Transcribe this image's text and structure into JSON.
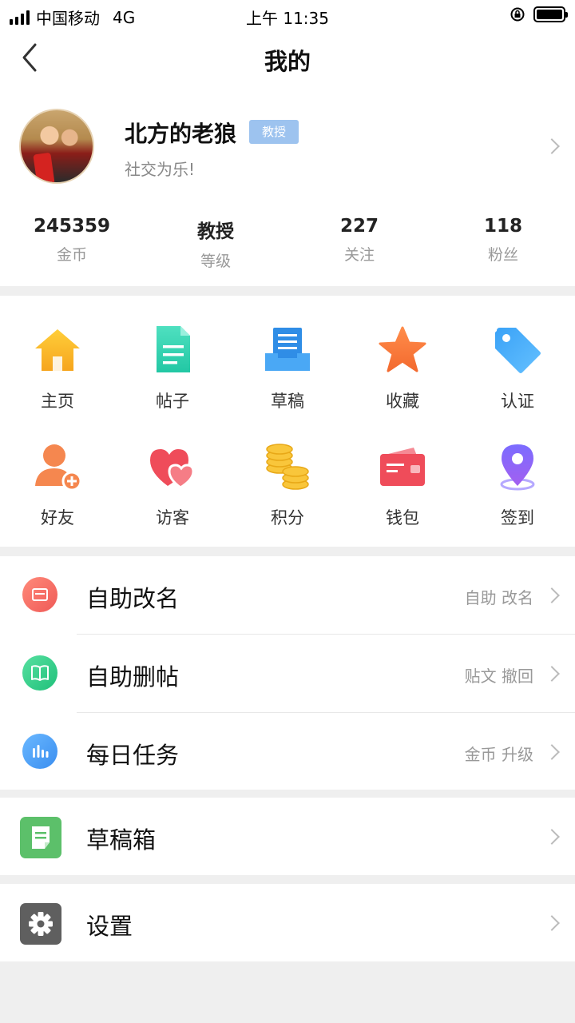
{
  "status": {
    "carrier": "中国移动",
    "network": "4G",
    "time": "上午 11:35"
  },
  "nav": {
    "title": "我的",
    "back_icon": "chevron-left-icon"
  },
  "profile": {
    "username": "北方的老狼",
    "badge": "教授",
    "signature": "社交为乐!",
    "stats": [
      {
        "value": "245359",
        "label": "金币"
      },
      {
        "value": "教授",
        "label": "等级"
      },
      {
        "value": "227",
        "label": "关注"
      },
      {
        "value": "118",
        "label": "粉丝"
      }
    ]
  },
  "grid": [
    {
      "label": "主页",
      "icon": "home-icon"
    },
    {
      "label": "帖子",
      "icon": "document-icon"
    },
    {
      "label": "草稿",
      "icon": "draft-tray-icon"
    },
    {
      "label": "收藏",
      "icon": "star-icon"
    },
    {
      "label": "认证",
      "icon": "tag-icon"
    },
    {
      "label": "好友",
      "icon": "add-friend-icon"
    },
    {
      "label": "访客",
      "icon": "hearts-icon"
    },
    {
      "label": "积分",
      "icon": "coins-icon"
    },
    {
      "label": "钱包",
      "icon": "wallet-icon"
    },
    {
      "label": "签到",
      "icon": "location-pin-icon"
    }
  ],
  "list": [
    {
      "label": "自助改名",
      "hint": "自助  改名",
      "icon": "card-icon",
      "color": "#f26b61"
    },
    {
      "label": "自助删帖",
      "hint": "贴文  撤回",
      "icon": "book-icon",
      "color": "#37cf86"
    },
    {
      "label": "每日任务",
      "hint": "金币  升级",
      "icon": "bar-chart-icon",
      "color": "#4aa3f5"
    }
  ],
  "drafts": {
    "label": "草稿箱",
    "icon": "note-icon",
    "color": "#5cc06a"
  },
  "settings": {
    "label": "设置",
    "icon": "gear-icon",
    "color": "#5f5f5f"
  }
}
